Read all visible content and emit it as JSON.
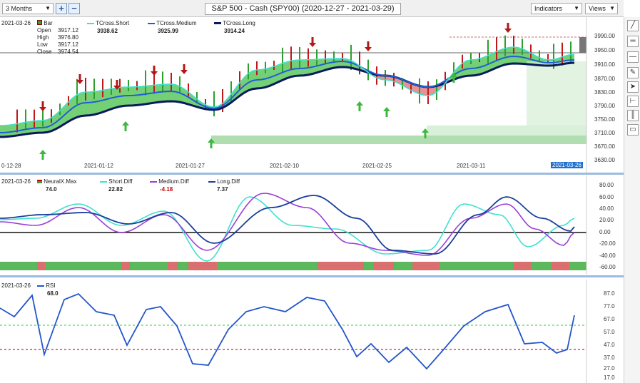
{
  "toolbar": {
    "period": "3 Months",
    "zoom_in": "+",
    "zoom_out": "−",
    "title": "S&P 500 - Cash (SPY00) (2020-12-27 - 2021-03-29)",
    "indicators": "Indicators",
    "views": "Views"
  },
  "price_pane": {
    "date": "2021-03-26",
    "bar_label": "Bar",
    "open_label": "Open",
    "open": "3917.12",
    "high_label": "High",
    "high": "3976.80",
    "low_label": "Low",
    "low": "3917.12",
    "close_label": "Close",
    "close": "3974.54",
    "tcross_short_label": "TCross.Short",
    "tcross_short": "3938.62",
    "tcross_medium_label": "TCross.Medium",
    "tcross_medium": "3925.99",
    "tcross_long_label": "TCross.Long",
    "tcross_long": "3914.24",
    "y_ticks": [
      "3990.00",
      "3950.00",
      "3910.00",
      "3870.00",
      "3830.00",
      "3790.00",
      "3750.00",
      "3710.00",
      "3670.00",
      "3630.00"
    ],
    "x_ticks": [
      "0-12-28",
      "2021-01-12",
      "2021-01-27",
      "2021-02-10",
      "2021-02-25",
      "2021-03-11"
    ],
    "selected_date": "2021-03-26",
    "colors": {
      "short": "#40e0d0",
      "medium": "#1f5fd6",
      "long": "#0a1a5a",
      "fill_up": "#5cc85c",
      "fill_down": "#e08080",
      "arrow_down": "#b01818",
      "arrow_up": "#3cb83c"
    }
  },
  "osc_pane": {
    "date": "2021-03-26",
    "neural_label": "NeuralX.Max",
    "neural": "74.0",
    "short_diff_label": "Short.Diff",
    "short_diff": "22.82",
    "medium_diff_label": "Medium.Diff",
    "medium_diff": "-4.18",
    "long_diff_label": "Long.Diff",
    "long_diff": "7.37",
    "y_ticks": [
      "80.00",
      "60.00",
      "40.00",
      "20.00",
      "0.00",
      "-20.00",
      "-40.00",
      "-60.00"
    ]
  },
  "rsi_pane": {
    "date": "2021-03-26",
    "rsi_label": "RSI",
    "rsi": "68.0",
    "y_ticks": [
      "87.0",
      "77.0",
      "67.0",
      "57.0",
      "47.0",
      "37.0",
      "27.0",
      "17.0"
    ]
  },
  "icons": [
    "line-tool-icon",
    "hline-tool-icon",
    "minus-tool-icon",
    "pencil-icon",
    "cursor-icon",
    "ruler-icon",
    "bars-icon",
    "note-icon"
  ]
}
